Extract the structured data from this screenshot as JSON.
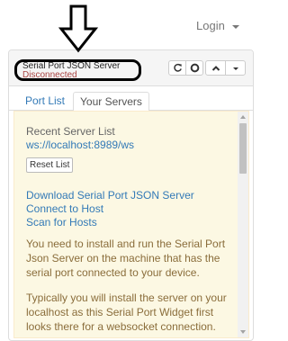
{
  "topbar": {
    "login_label": "Login"
  },
  "panel": {
    "title": "Serial Port JSON Server",
    "status": "Disconnected",
    "tabs": [
      {
        "label": "Port List",
        "active": false
      },
      {
        "label": "Your Servers",
        "active": true
      }
    ],
    "buttons": [
      "refresh-icon",
      "stop-icon",
      "chevron-up-icon",
      "caret-down-icon"
    ]
  },
  "servers": {
    "recent_heading": "Recent Server List",
    "recent_item": "ws://localhost:8989/ws",
    "reset_label": "Reset List",
    "links": [
      "Download Serial Port JSON Server",
      "Connect to Host",
      "Scan for Hosts"
    ],
    "para1_lines": [
      "You need to install and run the Serial Port",
      "Json Server on the machine that has the",
      "serial port connected to your device."
    ],
    "para2_lines": [
      "Typically you will install the server on your",
      "localhost as this Serial Port Widget first",
      "looks there for a websocket connection."
    ]
  },
  "colors": {
    "status": "#a94442",
    "link": "#337ab7",
    "content_bg": "#fcf8e3",
    "annotation": "#000000"
  }
}
